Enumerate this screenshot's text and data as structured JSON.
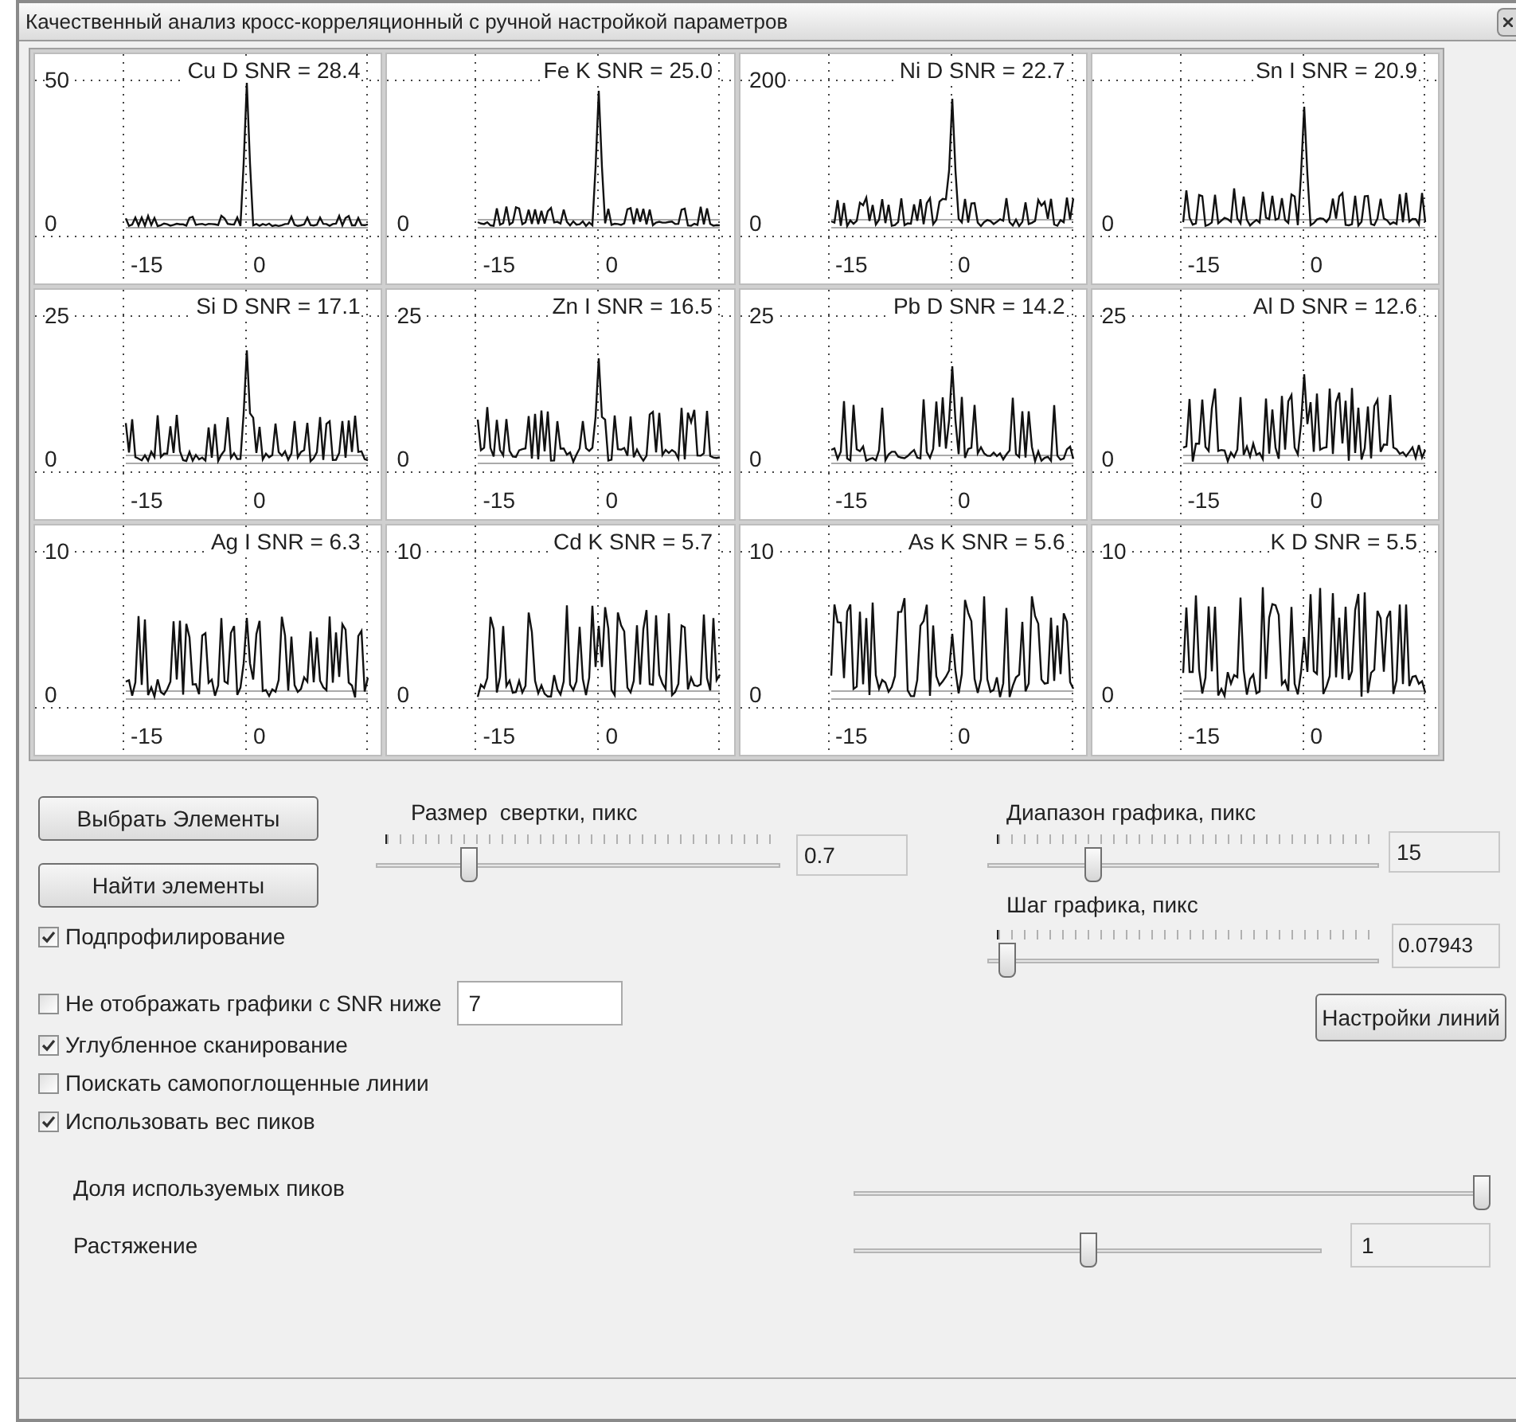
{
  "window": {
    "title": "Качественный анализ кросс-корреляционный с ручной настройкой параметров"
  },
  "charts": [
    {
      "title": "Cu D SNR = 28.4",
      "y_max": "50",
      "y_zero": "0",
      "x_ticks": [
        "-15",
        "0"
      ]
    },
    {
      "title": "Fe K SNR = 25.0",
      "y_zero": "0",
      "x_ticks": [
        "-15",
        "0"
      ]
    },
    {
      "title": "Ni D SNR = 22.7",
      "y_max": "200",
      "y_zero": "0",
      "x_ticks": [
        "-15",
        "0"
      ]
    },
    {
      "title": "Sn I SNR = 20.9",
      "y_zero": "0",
      "x_ticks": [
        "-15",
        "0"
      ]
    },
    {
      "title": "Si D SNR = 17.1",
      "y_max": "25",
      "y_zero": "0",
      "x_ticks": [
        "-15",
        "0"
      ]
    },
    {
      "title": "Zn I SNR = 16.5",
      "y_max": "25",
      "y_zero": "0",
      "x_ticks": [
        "-15",
        "0"
      ]
    },
    {
      "title": "Pb D SNR = 14.2",
      "y_max": "25",
      "y_zero": "0",
      "x_ticks": [
        "-15",
        "0"
      ]
    },
    {
      "title": "Al D SNR = 12.6",
      "y_max": "25",
      "y_zero": "0",
      "x_ticks": [
        "-15",
        "0"
      ]
    },
    {
      "title": "Ag I SNR = 6.3",
      "y_max": "10",
      "y_zero": "0",
      "x_ticks": [
        "-15",
        "0"
      ]
    },
    {
      "title": "Cd K SNR = 5.7",
      "y_max": "10",
      "y_zero": "0",
      "x_ticks": [
        "-15",
        "0"
      ]
    },
    {
      "title": "As K SNR = 5.6",
      "y_max": "10",
      "y_zero": "0",
      "x_ticks": [
        "-15",
        "0"
      ]
    },
    {
      "title": "K D SNR = 5.5",
      "y_max": "10",
      "y_zero": "0",
      "x_ticks": [
        "-15",
        "0"
      ]
    }
  ],
  "select_button": "Выбрать Элементы",
  "find_button": "Найти элементы",
  "convolution": {
    "label": "Размер  свертки, пикс",
    "level": 0.22,
    "value": "0.7"
  },
  "range": {
    "label": "Диапазон графика, пикс",
    "level": 0.26,
    "value": "15"
  },
  "step": {
    "label": "Шаг графика, пикс",
    "level": 0.03,
    "value": "0.07943"
  },
  "subprofiling": {
    "label": "Подпрофилирование",
    "checked": true
  },
  "snr_filter": {
    "label": "Не отображать графики с SNR ниже",
    "checked": false,
    "value": "7"
  },
  "options": [
    {
      "label": "Углубленное сканирование",
      "checked": true
    },
    {
      "label": "Поискать самопоглощенные линии",
      "checked": false
    },
    {
      "label": "Использовать вес пиков",
      "checked": true
    }
  ],
  "line_settings_button": "Настройки линий",
  "peak_share": {
    "label": "Доля используемых пиков",
    "level": 1.0
  },
  "stretch": {
    "label": "Растяжение",
    "level": 0.5,
    "value": "1"
  }
}
